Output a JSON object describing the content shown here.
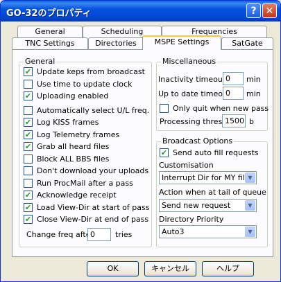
{
  "window": {
    "title": "GO-32のプロパティ"
  },
  "titlebar_buttons": {
    "help": "?",
    "close": "✕"
  },
  "tabs_row1": [
    "General",
    "Scheduling",
    "Frequencies"
  ],
  "tabs_row2": [
    "TNC Settings",
    "Directories",
    "MSPE Settings",
    "SatGate"
  ],
  "active_tab": "MSPE Settings",
  "general": {
    "title": "General",
    "checkboxes": [
      {
        "label": "Update keps from broadcast",
        "checked": true
      },
      {
        "label": "Use time to update clock",
        "checked": false
      },
      {
        "label": "Uploading enabled",
        "checked": true
      },
      {
        "label": "Automatically select U/L freq.",
        "checked": false
      },
      {
        "label": "Log KISS frames",
        "checked": true
      },
      {
        "label": "Log Telemetry frames",
        "checked": true
      },
      {
        "label": "Grab all heard files",
        "checked": true
      },
      {
        "label": "Block ALL BBS files",
        "checked": false
      },
      {
        "label": "Don't download your uploads",
        "checked": false
      },
      {
        "label": "Run ProcMail after a pass",
        "checked": false
      },
      {
        "label": "Acknowledge receipt",
        "checked": true
      },
      {
        "label": "Load View-Dir at start of pass",
        "checked": true
      },
      {
        "label": "Close View-Dir at end of pass",
        "checked": true
      }
    ],
    "change_freq_label": "Change freq after",
    "change_freq_value": "0",
    "tries_label": "tries"
  },
  "misc": {
    "title": "Miscellaneous",
    "inactivity_label": "Inactivity timeout",
    "inactivity_value": "0",
    "inactivity_unit": "min",
    "uptodate_label": "Up to date timeout",
    "uptodate_value": "0",
    "uptodate_unit": "min",
    "only_quit_label": "Only quit when new pass",
    "only_quit_checked": false,
    "processing_label": "Processing thresh",
    "processing_value": "1500",
    "processing_unit": "b"
  },
  "broadcast": {
    "title": "Broadcast Options",
    "send_auto_label": "Send auto fill requests",
    "send_auto_checked": true,
    "customisation_label": "Customisation",
    "customisation_value": "Interrupt Dir for MY files",
    "tail_label": "Action when at tail of queue",
    "tail_value": "Send new request",
    "priority_label": "Directory Priority",
    "priority_value": "Auto3"
  },
  "buttons": {
    "ok": "OK",
    "cancel": "キャンセル",
    "help": "ヘルプ"
  }
}
